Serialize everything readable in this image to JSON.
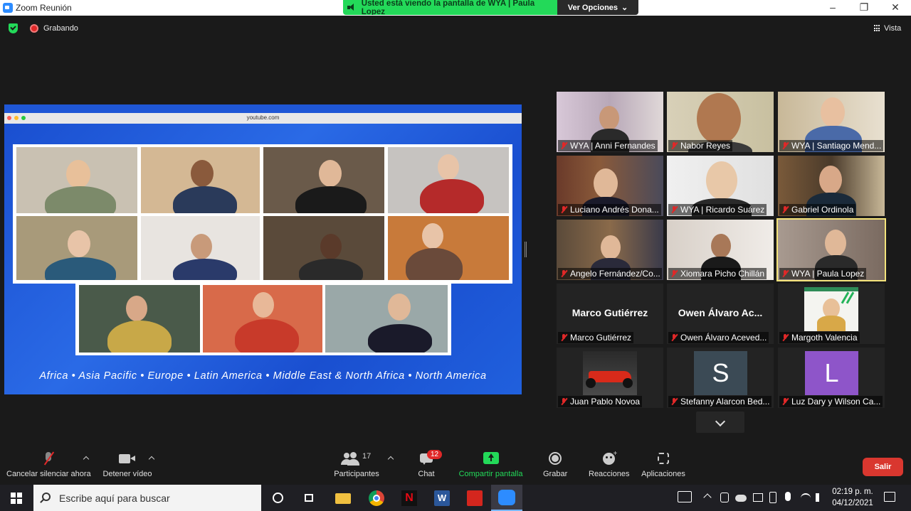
{
  "window": {
    "title": "Zoom Reunión",
    "minimize": "–",
    "restore": "❐",
    "close": "✕"
  },
  "share_banner": {
    "text": "Usted está viendo la pantalla de WYA | Paula Lopez",
    "options_label": "Ver Opciones",
    "options_caret": "⌄"
  },
  "meeting_bar": {
    "recording_label": "Grabando",
    "view_label": "Vista"
  },
  "shared_screen": {
    "url": "youtube.com",
    "regions": [
      "Africa",
      "Asia Pacific",
      "Europe",
      "Latin America",
      "Middle East & North Africa",
      "North America"
    ],
    "regions_text": "Africa  •  Asia Pacific  •  Europe  •  Latin America  •  Middle East & North Africa  •  North America"
  },
  "participants": [
    {
      "name": "WYA | Anni Fernandes",
      "muted": true
    },
    {
      "name": "Nabor Reyes",
      "muted": true
    },
    {
      "name": "WYA | Santiago Mend...",
      "muted": true
    },
    {
      "name": "Luciano Andrés Dona...",
      "muted": true
    },
    {
      "name": "WYA | Ricardo Suárez",
      "muted": true
    },
    {
      "name": "Gabriel Ordinola",
      "muted": true
    },
    {
      "name": "Angelo Fernández/Co...",
      "muted": true
    },
    {
      "name": "Xiomara Picho Chillán",
      "muted": true
    },
    {
      "name": "WYA | Paula Lopez",
      "muted": true,
      "active_speaker": true
    },
    {
      "name": "Marco Gutiérrez",
      "display": "Marco Gutiérrez",
      "muted": true
    },
    {
      "name": "Owen Álvaro Aceved...",
      "display": "Owen Álvaro Ac...",
      "muted": true
    },
    {
      "name": "Margoth Valencia",
      "muted": true
    },
    {
      "name": "Juan Pablo Novoa",
      "muted": true
    },
    {
      "name": "Stefanny Alarcon Bed...",
      "avatar_letter": "S",
      "avatar_color": "#3b4a55",
      "muted": true
    },
    {
      "name": "Luz Dary y Wilson Ca...",
      "avatar_letter": "L",
      "avatar_color": "#8e55c9",
      "muted": true
    }
  ],
  "toolbar": {
    "mute_label": "Cancelar silenciar ahora",
    "video_label": "Detener vídeo",
    "participants_label": "Participantes",
    "participants_count": "17",
    "chat_label": "Chat",
    "chat_badge": "12",
    "share_label": "Compartir pantalla",
    "record_label": "Grabar",
    "reactions_label": "Reacciones",
    "apps_label": "Aplicaciones",
    "leave_label": "Salir"
  },
  "taskbar": {
    "search_placeholder": "Escribe aquí para buscar",
    "time": "02:19 p. m.",
    "date": "04/12/2021"
  },
  "colors": {
    "accent_green": "#23d959",
    "leave_red": "#d9372f",
    "active_speaker_border": "#f4e37b",
    "shared_bg_blue": "#1f57d6"
  }
}
